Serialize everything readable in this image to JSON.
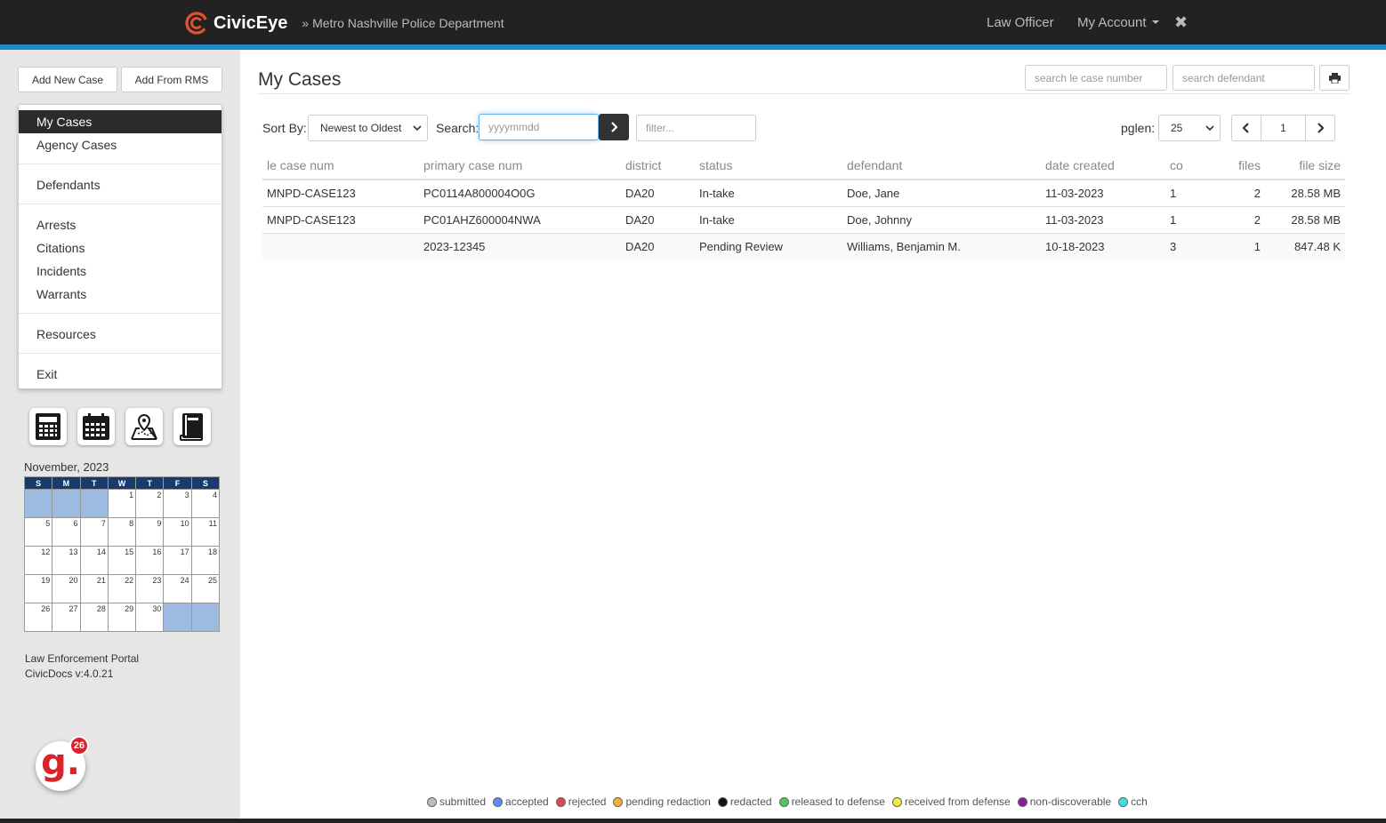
{
  "header": {
    "brand_name": "CivicEye",
    "department": "» Metro Nashville Police Department",
    "officer_label": "Law Officer",
    "account_label": "My Account",
    "close_glyph": "✖"
  },
  "sidebar": {
    "add_new_label": "Add New Case",
    "add_rms_label": "Add From RMS",
    "nav": {
      "my_cases": "My Cases",
      "agency_cases": "Agency Cases",
      "defendants": "Defendants",
      "arrests": "Arrests",
      "citations": "Citations",
      "incidents": "Incidents",
      "warrants": "Warrants",
      "resources": "Resources",
      "exit": "Exit"
    },
    "tools": [
      "calculator-icon",
      "calendar-icon",
      "map-icon",
      "book-icon"
    ],
    "calendar": {
      "title": "November, 2023",
      "days": [
        "S",
        "M",
        "T",
        "W",
        "T",
        "F",
        "S"
      ],
      "weeks": [
        [
          "",
          "",
          "",
          "1",
          "2",
          "3",
          "4"
        ],
        [
          "5",
          "6",
          "7",
          "8",
          "9",
          "10",
          "11"
        ],
        [
          "12",
          "13",
          "14",
          "15",
          "16",
          "17",
          "18"
        ],
        [
          "19",
          "20",
          "21",
          "22",
          "23",
          "24",
          "25"
        ],
        [
          "26",
          "27",
          "28",
          "29",
          "30",
          "",
          ""
        ]
      ]
    },
    "portal_name": "Law Enforcement Portal",
    "version": "CivicDocs v:4.0.21",
    "badge_letter": "g.",
    "badge_count": "26"
  },
  "main": {
    "title": "My Cases",
    "search_le_placeholder": "search le case number",
    "search_defendant_placeholder": "search defendant",
    "sort_label": "Sort By:",
    "sort_value": "Newest to Oldest",
    "search_label": "Search:",
    "date_placeholder": "yyyymmdd",
    "filter_placeholder": "filter...",
    "pglen_label": "pglen:",
    "pglen_value": "25",
    "page_number": "1"
  },
  "table": {
    "columns": {
      "le": "le case num",
      "primary": "primary case num",
      "district": "district",
      "status": "status",
      "defendant": "defendant",
      "date": "date created",
      "co": "co",
      "files": "files",
      "size": "file size"
    },
    "rows": [
      {
        "le": "MNPD-CASE123",
        "primary": "PC0114A800004O0G",
        "district": "DA20",
        "status": "In-take",
        "defendant": "Doe, Jane",
        "date": "11-03-2023",
        "co": "1",
        "files": "2",
        "size": "28.58 MB"
      },
      {
        "le": "MNPD-CASE123",
        "primary": "PC01AHZ600004NWA",
        "district": "DA20",
        "status": "In-take",
        "defendant": "Doe, Johnny",
        "date": "11-03-2023",
        "co": "1",
        "files": "2",
        "size": "28.58 MB"
      },
      {
        "le": "",
        "primary": "2023-12345",
        "district": "DA20",
        "status": "Pending Review",
        "defendant": "Williams, Benjamin M.",
        "date": "10-18-2023",
        "co": "3",
        "files": "1",
        "size": "847.48 K"
      }
    ]
  },
  "legend": [
    {
      "label": "submitted",
      "color": "#bdbdbd"
    },
    {
      "label": "accepted",
      "color": "#5b8def"
    },
    {
      "label": "rejected",
      "color": "#e0474c"
    },
    {
      "label": "pending redaction",
      "color": "#f3b13c"
    },
    {
      "label": "redacted",
      "color": "#111111"
    },
    {
      "label": "released to defense",
      "color": "#4cc85a"
    },
    {
      "label": "received from defense",
      "color": "#f2ea3a"
    },
    {
      "label": "non-discoverable",
      "color": "#8a1a9a"
    },
    {
      "label": "cch",
      "color": "#3fe0e8"
    }
  ]
}
